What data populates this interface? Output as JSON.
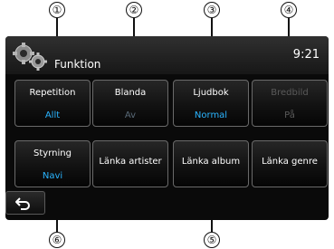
{
  "callouts": [
    "①",
    "②",
    "③",
    "④",
    "⑤",
    "⑥"
  ],
  "header": {
    "title": "Funktion",
    "clock": "9:21"
  },
  "tiles": [
    {
      "label": "Repetition",
      "value": "Allt",
      "enabled": true
    },
    {
      "label": "Blanda",
      "value": "Av",
      "enabled": true
    },
    {
      "label": "Ljudbok",
      "value": "Normal",
      "enabled": true
    },
    {
      "label": "Bredbild",
      "value": "På",
      "enabled": false
    },
    {
      "label": "Styrning",
      "value": "Navi",
      "enabled": true
    },
    {
      "label": "Länka artister",
      "enabled": true
    },
    {
      "label": "Länka album",
      "enabled": true
    },
    {
      "label": "Länka genre",
      "enabled": true
    }
  ],
  "colors": {
    "value_text": "#2ab4ff",
    "disabled_text": "#5a5a5a",
    "screen_bg": "#0a0a0a"
  },
  "icons": {
    "header": "gear-icon",
    "back": "back-arrow-icon"
  }
}
